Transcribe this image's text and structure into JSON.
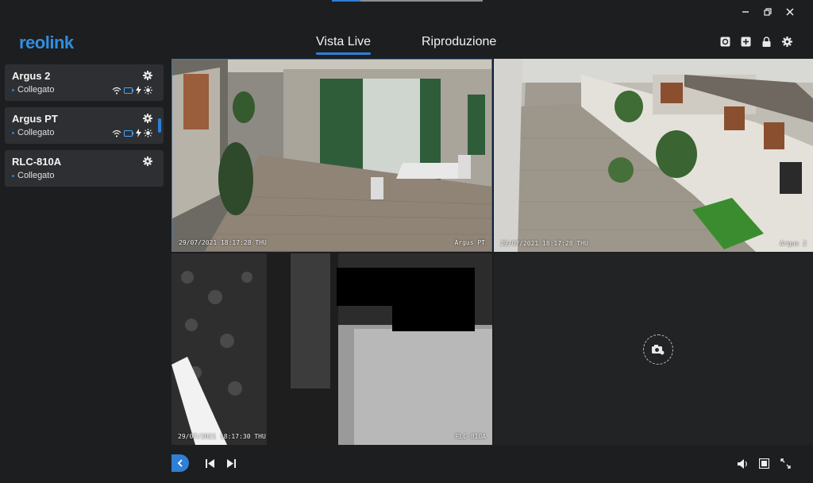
{
  "app": {
    "logo_text": "reolink"
  },
  "window_controls": {
    "minimize_icon": "minimize-icon",
    "restore_icon": "restore-icon",
    "close_icon": "close-icon"
  },
  "nav": {
    "tabs": [
      {
        "label": "Vista Live",
        "active": true
      },
      {
        "label": "Riproduzione",
        "active": false
      }
    ]
  },
  "toolbar": {
    "icons": [
      "reset-icon",
      "add-icon",
      "lock-icon",
      "settings-icon"
    ]
  },
  "sidebar": {
    "cameras": [
      {
        "name": "Argus 2",
        "status": "Collegato",
        "indicators": [
          "wifi-icon",
          "battery-icon",
          "bolt-icon",
          "sun-icon"
        ]
      },
      {
        "name": "Argus PT",
        "status": "Collegato",
        "indicators": [
          "wifi-icon",
          "battery-icon",
          "bolt-icon",
          "sun-icon"
        ]
      },
      {
        "name": "RLC-810A",
        "status": "Collegato",
        "indicators": []
      }
    ]
  },
  "grid": {
    "cells": [
      {
        "camera": "Argus PT",
        "timestamp": "29/07/2021 18:17:28 THU",
        "selected": true
      },
      {
        "camera": "Argus 2",
        "timestamp": "29/07/2021 18:17:28 THU",
        "selected": false
      },
      {
        "camera": "RLC-810A",
        "timestamp": "29/07/2021 18:17:30 THU",
        "selected": false
      },
      {
        "camera": "",
        "timestamp": "",
        "empty": true
      }
    ]
  },
  "bottombar": {
    "icons": [
      "collapse-left-icon",
      "previous-icon",
      "next-icon",
      "volume-icon",
      "layout-icon",
      "fullscreen-icon"
    ]
  },
  "colors": {
    "accent": "#2f7fd6",
    "background": "#1d1e20",
    "card": "#2e2f32"
  }
}
